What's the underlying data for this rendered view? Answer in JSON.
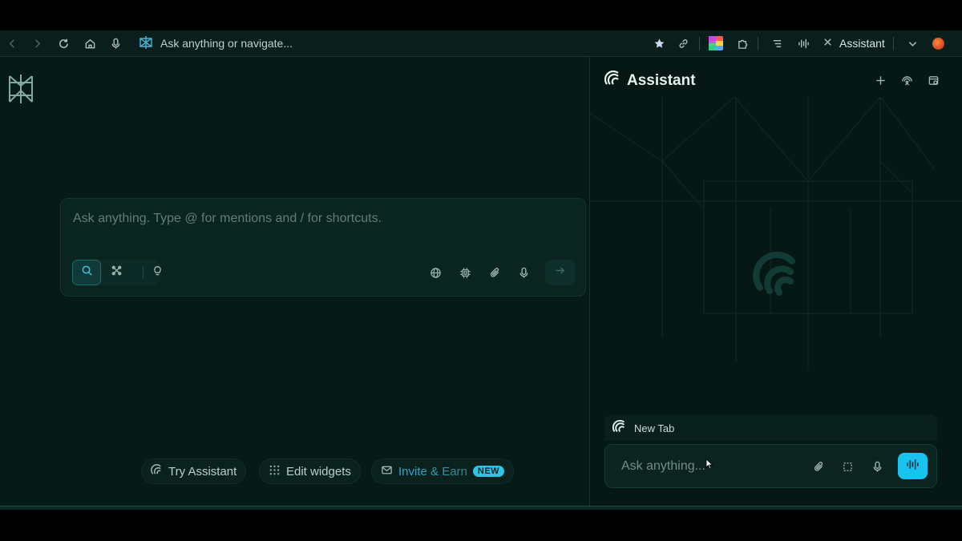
{
  "toolbar": {
    "address_placeholder": "Ask anything or navigate...",
    "assistant_tab_label": "Assistant",
    "icons": [
      "back-icon",
      "forward-icon",
      "reload-icon",
      "home-icon",
      "mic-icon",
      "star-icon",
      "link-icon",
      "extensions-icon",
      "menu-icon",
      "waveform-icon",
      "close-icon",
      "chevron-down-icon"
    ]
  },
  "main": {
    "composer_placeholder": "Ask anything. Type @ for mentions and / for shortcuts.",
    "pills": {
      "try_assistant": "Try Assistant",
      "edit_widgets": "Edit widgets",
      "invite": "Invite & Earn",
      "new_badge": "NEW"
    }
  },
  "panel": {
    "title": "Assistant",
    "context_label": "New Tab",
    "input_placeholder": "Ask anything..."
  },
  "colors": {
    "accent": "#19c3f0",
    "background": "#061a17",
    "panel_background": "#051814"
  }
}
